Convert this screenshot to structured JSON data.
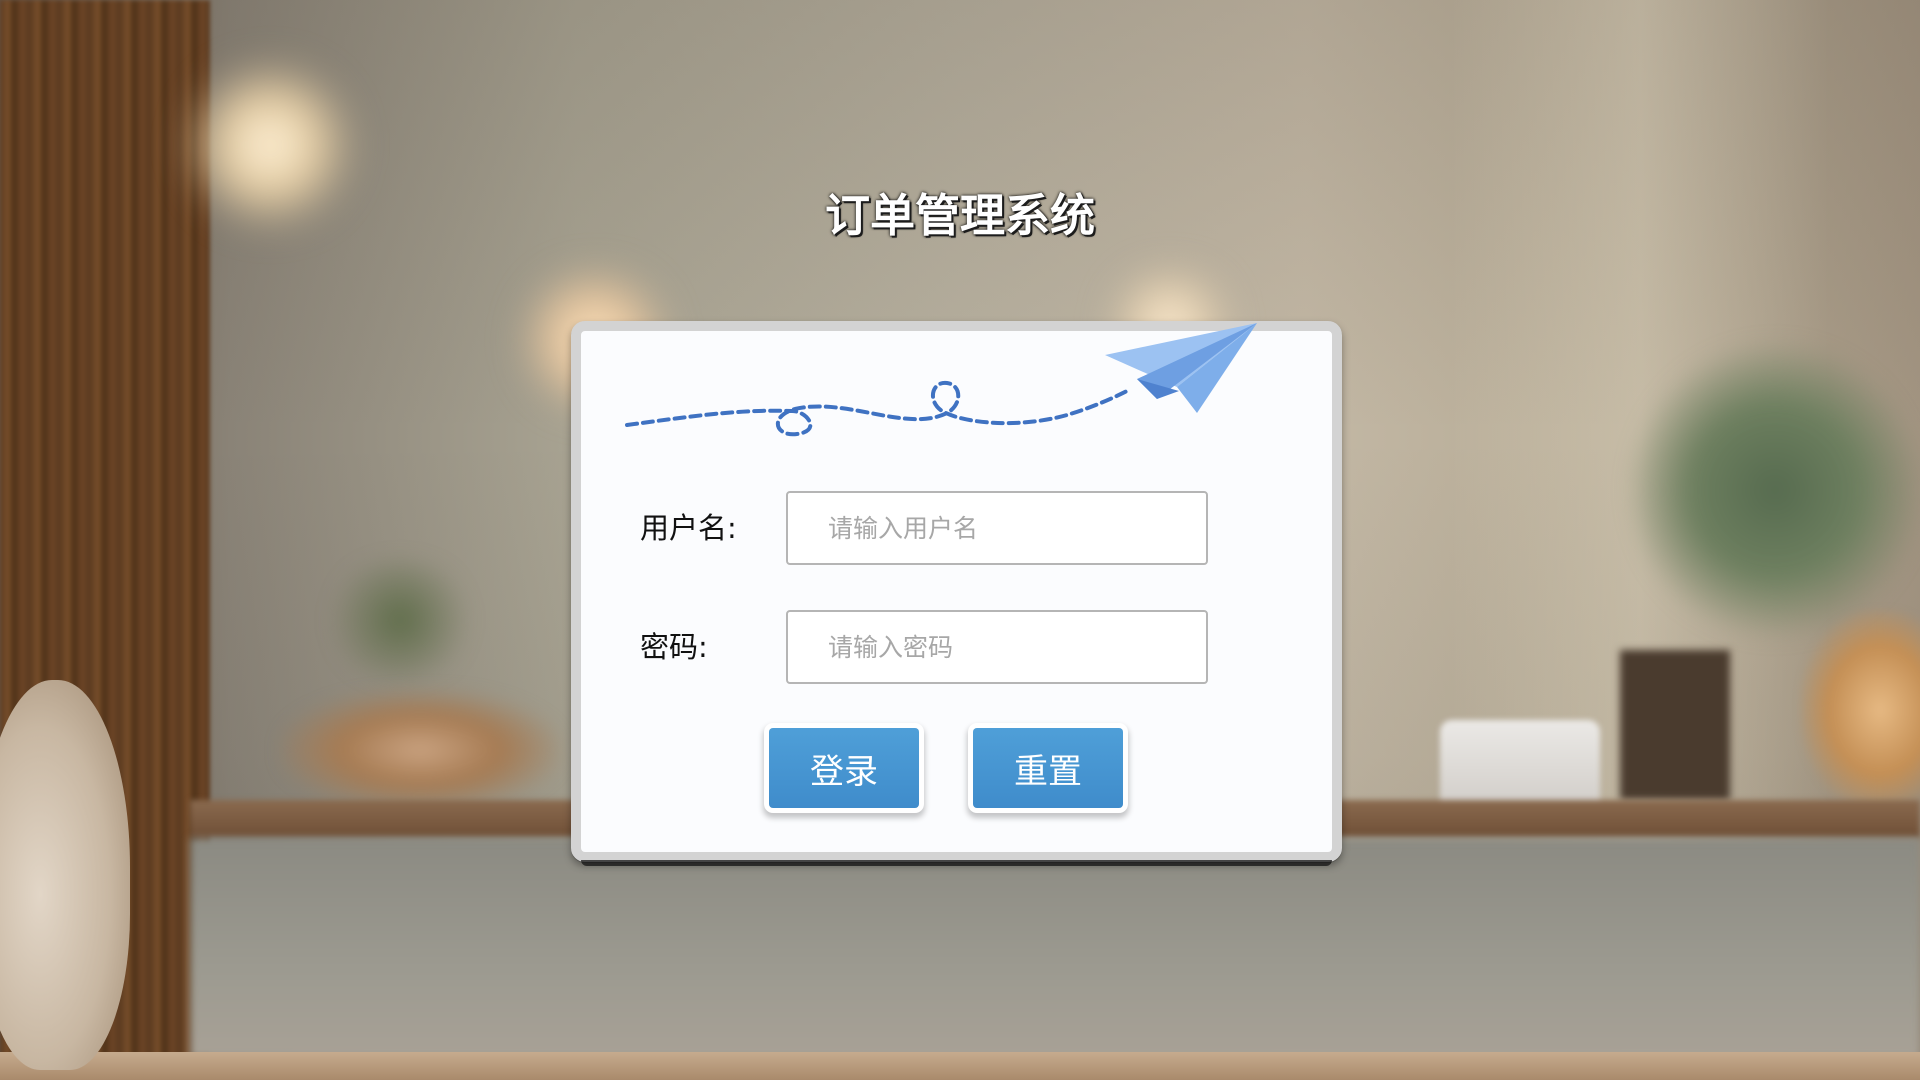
{
  "page": {
    "title": "订单管理系统"
  },
  "login_form": {
    "username_label": "用户名:",
    "username_placeholder": "请输入用户名",
    "username_value": "",
    "password_label": "密码:",
    "password_placeholder": "请输入密码",
    "password_value": "",
    "login_button": "登录",
    "reset_button": "重置"
  },
  "decoration": {
    "icon": "paper-plane-icon",
    "trail": "dashed-loop-trail",
    "trail_color": "#3f72c2",
    "plane_color": "#8ab6ef"
  },
  "colors": {
    "button_bg": "#4396d2",
    "card_bg": "#fbfcfe",
    "card_border": "#d3d3d3",
    "title_text": "#ffffff"
  }
}
